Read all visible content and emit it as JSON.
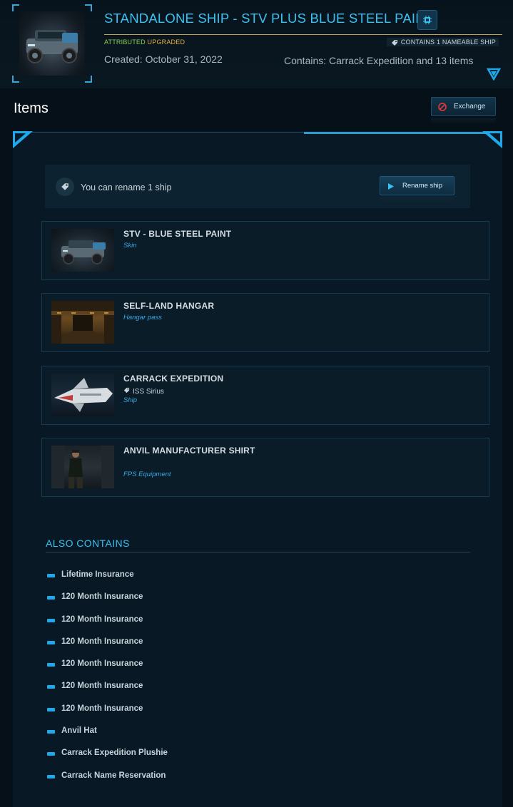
{
  "header": {
    "title": "STANDALONE SHIP - STV PLUS BLUE STEEL PAINT",
    "badge_attributed": "ATTRIBUTED",
    "badge_upgraded": "UPGRADED",
    "nameable": "CONTAINS 1 NAMEABLE SHIP",
    "created": "Created: October 31, 2022",
    "contains": "Contains: Carrack Expedition and 13 items"
  },
  "items_section": {
    "title": "Items",
    "exchange_label": "Exchange",
    "rename_text": "You can rename 1 ship",
    "rename_button": "Rename ship"
  },
  "items": [
    {
      "name": "STV - BLUE STEEL PAINT",
      "type": "Skin",
      "subname": ""
    },
    {
      "name": "SELF-LAND HANGAR",
      "type": "Hangar pass",
      "subname": ""
    },
    {
      "name": "CARRACK EXPEDITION",
      "type": "Ship",
      "subname": "ISS Sirius"
    },
    {
      "name": "ANVIL MANUFACTURER SHIRT",
      "type": "FPS Equipment",
      "subname": ""
    }
  ],
  "also_contains": {
    "title": "ALSO CONTAINS",
    "items": [
      "Lifetime Insurance",
      "120 Month Insurance",
      "120 Month Insurance",
      "120 Month Insurance",
      "120 Month Insurance",
      "120 Month Insurance",
      "120 Month Insurance",
      "Anvil Hat",
      "Carrack Expedition Plushie",
      "Carrack Name Reservation"
    ]
  },
  "colors": {
    "accent": "#39c2f0",
    "attributed": "#8bd24a",
    "upgraded": "#e2b13a",
    "item_type": "#3aa8e6"
  }
}
